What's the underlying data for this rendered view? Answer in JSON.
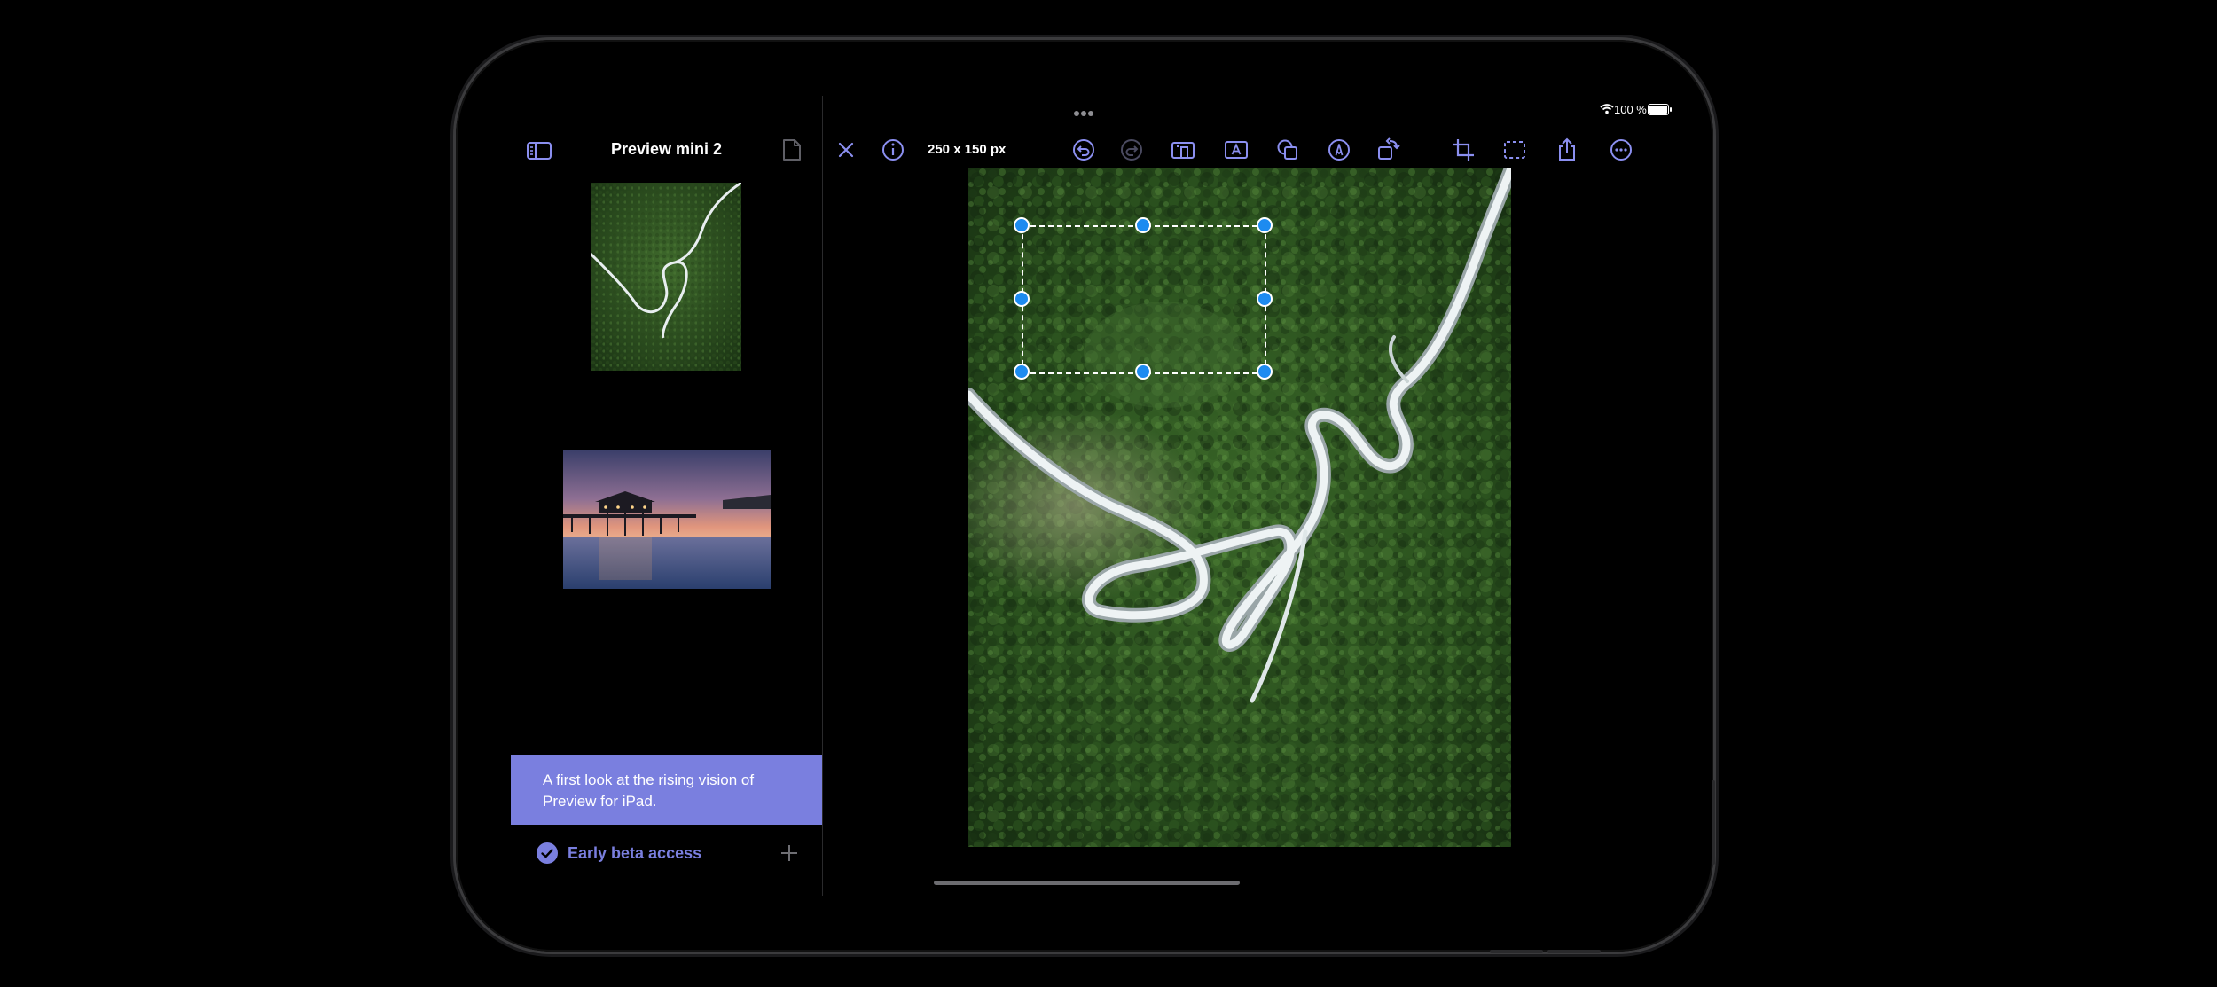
{
  "sidebar": {
    "title": "Preview mini 2",
    "toggle_icon": "sidebar-icon",
    "document_icon": "document-icon",
    "thumbnails": [
      {
        "name": "aerial-forest-road"
      },
      {
        "name": "pier-sunset"
      }
    ],
    "banner_text": "A first look at the rising vision of Preview for iPad.",
    "beta_label": "Early beta access",
    "beta_icon": "checkmark-circle-icon",
    "add_icon": "plus-icon"
  },
  "toolbar": {
    "dimensions": "250 x 150 px",
    "icons": [
      "close-icon",
      "info-icon",
      "undo-icon",
      "redo-icon",
      "fit-icon",
      "text-box-icon",
      "shapes-icon",
      "markup-pen-icon",
      "rotate-icon",
      "crop-icon",
      "selection-icon",
      "share-icon",
      "more-icon"
    ]
  },
  "status_bar": {
    "battery": "100 %"
  },
  "colors": {
    "accent": "#7a7fdf",
    "handle": "#1d8bf0",
    "toolbar_icon": "#8b8ff0"
  }
}
